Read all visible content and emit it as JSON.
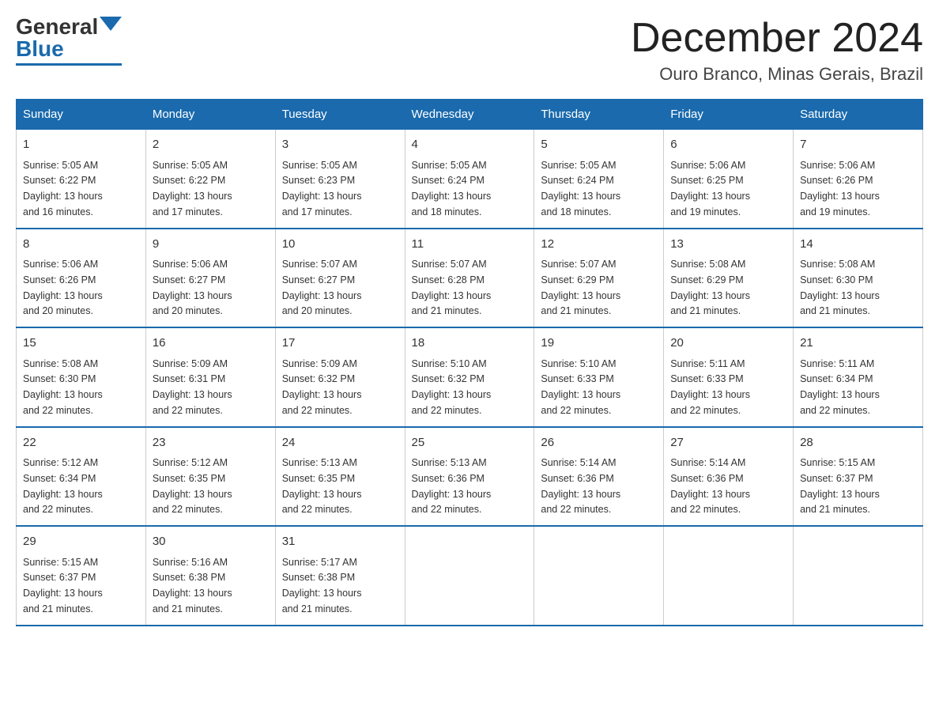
{
  "header": {
    "logo_general": "General",
    "logo_blue": "Blue",
    "month_title": "December 2024",
    "subtitle": "Ouro Branco, Minas Gerais, Brazil"
  },
  "days_of_week": [
    "Sunday",
    "Monday",
    "Tuesday",
    "Wednesday",
    "Thursday",
    "Friday",
    "Saturday"
  ],
  "weeks": [
    [
      {
        "day": "1",
        "sunrise": "5:05 AM",
        "sunset": "6:22 PM",
        "daylight": "13 hours and 16 minutes."
      },
      {
        "day": "2",
        "sunrise": "5:05 AM",
        "sunset": "6:22 PM",
        "daylight": "13 hours and 17 minutes."
      },
      {
        "day": "3",
        "sunrise": "5:05 AM",
        "sunset": "6:23 PM",
        "daylight": "13 hours and 17 minutes."
      },
      {
        "day": "4",
        "sunrise": "5:05 AM",
        "sunset": "6:24 PM",
        "daylight": "13 hours and 18 minutes."
      },
      {
        "day": "5",
        "sunrise": "5:05 AM",
        "sunset": "6:24 PM",
        "daylight": "13 hours and 18 minutes."
      },
      {
        "day": "6",
        "sunrise": "5:06 AM",
        "sunset": "6:25 PM",
        "daylight": "13 hours and 19 minutes."
      },
      {
        "day": "7",
        "sunrise": "5:06 AM",
        "sunset": "6:26 PM",
        "daylight": "13 hours and 19 minutes."
      }
    ],
    [
      {
        "day": "8",
        "sunrise": "5:06 AM",
        "sunset": "6:26 PM",
        "daylight": "13 hours and 20 minutes."
      },
      {
        "day": "9",
        "sunrise": "5:06 AM",
        "sunset": "6:27 PM",
        "daylight": "13 hours and 20 minutes."
      },
      {
        "day": "10",
        "sunrise": "5:07 AM",
        "sunset": "6:27 PM",
        "daylight": "13 hours and 20 minutes."
      },
      {
        "day": "11",
        "sunrise": "5:07 AM",
        "sunset": "6:28 PM",
        "daylight": "13 hours and 21 minutes."
      },
      {
        "day": "12",
        "sunrise": "5:07 AM",
        "sunset": "6:29 PM",
        "daylight": "13 hours and 21 minutes."
      },
      {
        "day": "13",
        "sunrise": "5:08 AM",
        "sunset": "6:29 PM",
        "daylight": "13 hours and 21 minutes."
      },
      {
        "day": "14",
        "sunrise": "5:08 AM",
        "sunset": "6:30 PM",
        "daylight": "13 hours and 21 minutes."
      }
    ],
    [
      {
        "day": "15",
        "sunrise": "5:08 AM",
        "sunset": "6:30 PM",
        "daylight": "13 hours and 22 minutes."
      },
      {
        "day": "16",
        "sunrise": "5:09 AM",
        "sunset": "6:31 PM",
        "daylight": "13 hours and 22 minutes."
      },
      {
        "day": "17",
        "sunrise": "5:09 AM",
        "sunset": "6:32 PM",
        "daylight": "13 hours and 22 minutes."
      },
      {
        "day": "18",
        "sunrise": "5:10 AM",
        "sunset": "6:32 PM",
        "daylight": "13 hours and 22 minutes."
      },
      {
        "day": "19",
        "sunrise": "5:10 AM",
        "sunset": "6:33 PM",
        "daylight": "13 hours and 22 minutes."
      },
      {
        "day": "20",
        "sunrise": "5:11 AM",
        "sunset": "6:33 PM",
        "daylight": "13 hours and 22 minutes."
      },
      {
        "day": "21",
        "sunrise": "5:11 AM",
        "sunset": "6:34 PM",
        "daylight": "13 hours and 22 minutes."
      }
    ],
    [
      {
        "day": "22",
        "sunrise": "5:12 AM",
        "sunset": "6:34 PM",
        "daylight": "13 hours and 22 minutes."
      },
      {
        "day": "23",
        "sunrise": "5:12 AM",
        "sunset": "6:35 PM",
        "daylight": "13 hours and 22 minutes."
      },
      {
        "day": "24",
        "sunrise": "5:13 AM",
        "sunset": "6:35 PM",
        "daylight": "13 hours and 22 minutes."
      },
      {
        "day": "25",
        "sunrise": "5:13 AM",
        "sunset": "6:36 PM",
        "daylight": "13 hours and 22 minutes."
      },
      {
        "day": "26",
        "sunrise": "5:14 AM",
        "sunset": "6:36 PM",
        "daylight": "13 hours and 22 minutes."
      },
      {
        "day": "27",
        "sunrise": "5:14 AM",
        "sunset": "6:36 PM",
        "daylight": "13 hours and 22 minutes."
      },
      {
        "day": "28",
        "sunrise": "5:15 AM",
        "sunset": "6:37 PM",
        "daylight": "13 hours and 21 minutes."
      }
    ],
    [
      {
        "day": "29",
        "sunrise": "5:15 AM",
        "sunset": "6:37 PM",
        "daylight": "13 hours and 21 minutes."
      },
      {
        "day": "30",
        "sunrise": "5:16 AM",
        "sunset": "6:38 PM",
        "daylight": "13 hours and 21 minutes."
      },
      {
        "day": "31",
        "sunrise": "5:17 AM",
        "sunset": "6:38 PM",
        "daylight": "13 hours and 21 minutes."
      },
      null,
      null,
      null,
      null
    ]
  ],
  "labels": {
    "sunrise": "Sunrise:",
    "sunset": "Sunset:",
    "daylight": "Daylight:"
  }
}
